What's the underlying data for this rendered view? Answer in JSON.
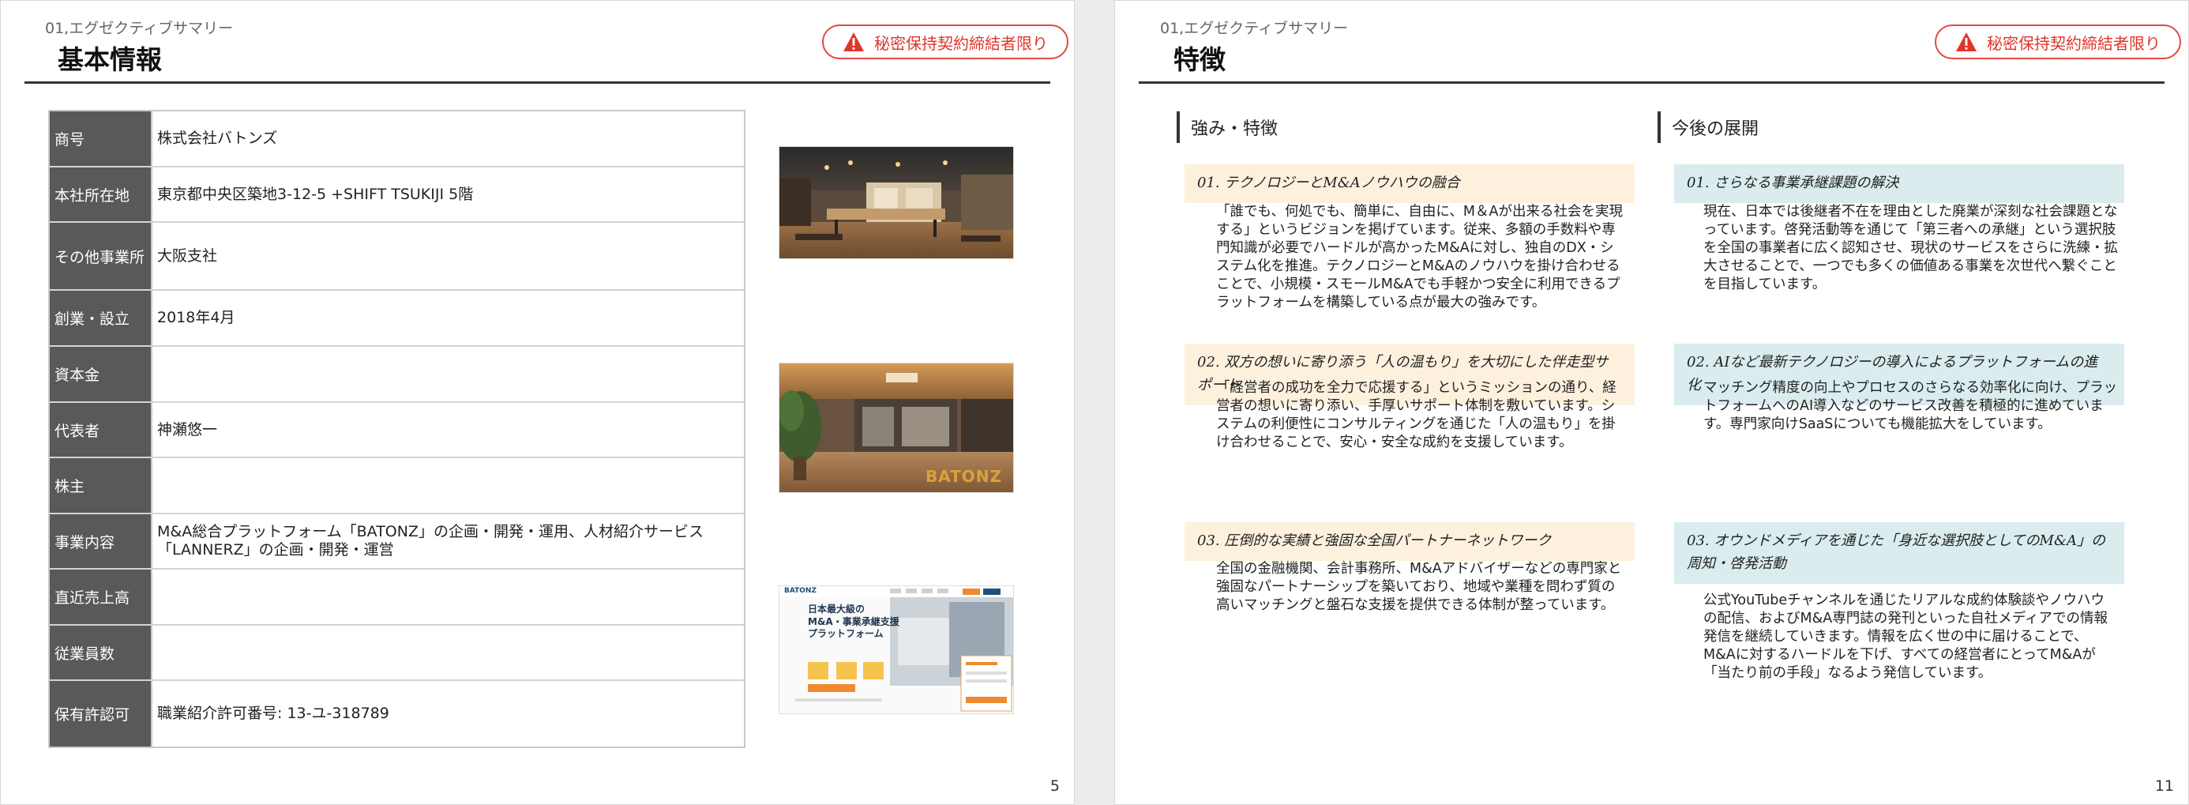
{
  "slide1": {
    "section_label": "01,エグゼクティブサマリー",
    "title": "基本情報",
    "confidential_badge": "秘密保持契約締結者限り",
    "page_number": "5",
    "rows": [
      {
        "label": "商号",
        "value": "株式会社バトンズ"
      },
      {
        "label": "本社所在地",
        "value": "東京都中央区築地3-12-5 +SHIFT TSUKIJI 5階"
      },
      {
        "label": "その他事業所",
        "value": "大阪支社"
      },
      {
        "label": "創業・設立",
        "value": "2018年4月"
      },
      {
        "label": "資本金",
        "value": ""
      },
      {
        "label": "代表者",
        "value": "神瀬悠一"
      },
      {
        "label": "株主",
        "value": ""
      },
      {
        "label": "事業内容",
        "value": "M&A総合プラットフォーム「BATONZ」の企画・開発・運用、人材紹介サービス\n「LANNERZ」の企画・開発・運営"
      },
      {
        "label": "直近売上高",
        "value": ""
      },
      {
        "label": "従業員数",
        "value": ""
      },
      {
        "label": "保有許認可",
        "value": "職業紹介許可番号: 13-ユ-318789"
      }
    ],
    "photos": [
      {
        "icon": "office-lounge-photo"
      },
      {
        "icon": "office-entrance-photo",
        "overlay_text": "BATONZ"
      },
      {
        "icon": "website-screenshot",
        "site_logo": "BATONZ",
        "headline_lines": [
          "日本最大級の",
          "M&A・事業承継支援",
          "プラットフォーム"
        ]
      }
    ]
  },
  "slide2": {
    "section_label": "01,エグゼクティブサマリー",
    "title": "特徴",
    "confidential_badge": "秘密保持契約締結者限り",
    "page_number": "11",
    "left_heading": "強み・特徴",
    "right_heading": "今後の展開",
    "left_items": [
      {
        "title": "01. テクノロジーとM&Aノウハウの融合",
        "body": "「誰でも、何処でも、簡単に、自由に、M＆Aが出来る社会を実現する」というビジョンを掲げています。従来、多額の手数料や専門知識が必要でハードルが高かったM&Aに対し、独自のDX・システム化を推進。テクノロジーとM&Aのノウハウを掛け合わせることで、小規模・スモールM&Aでも手軽かつ安全に利用できるプラットフォームを構築している点が最大の強みです。"
      },
      {
        "title": "02. 双方の想いに寄り添う「人の温もり」を大切にした伴走型サポート",
        "body": "「経営者の成功を全力で応援する」というミッションの通り、経営者の想いに寄り添い、手厚いサポート体制を敷いています。システムの利便性にコンサルティングを通じた「人の温もり」を掛け合わせることで、安心・安全な成約を支援しています。"
      },
      {
        "title": "03. 圧倒的な実績と強固な全国パートナーネットワーク",
        "body": "全国の金融機関、会計事務所、M&Aアドバイザーなどの専門家と強固なパートナーシップを築いており、地域や業種を問わず質の高いマッチングと盤石な支援を提供できる体制が整っています。"
      }
    ],
    "right_items": [
      {
        "title": "01. さらなる事業承継課題の解決",
        "body": "現在、日本では後継者不在を理由とした廃業が深刻な社会課題となっています。啓発活動等を通じて「第三者への承継」という選択肢を全国の事業者に広く認知させ、現状のサービスをさらに洗練・拡大させることで、一つでも多くの価値ある事業を次世代へ繋ぐことを目指しています。"
      },
      {
        "title": "02. AIなど最新テクノロジーの導入によるプラットフォームの進化",
        "body": "マッチング精度の向上やプロセスのさらなる効率化に向け、プラットフォームへのAI導入などのサービス改善を積極的に進めています。専門家向けSaaSについても機能拡大をしています。"
      },
      {
        "title": "03. オウンドメディアを通じた「身近な選択肢としてのM&A」の周知・啓発活動",
        "body": "公式YouTubeチャンネルを通じたリアルな成約体験談やノウハウの配信、およびM&A専門誌の発刊といった自社メディアでの情報発信を継続していきます。情報を広く世の中に届けることで、M&Aに対するハードルを下げ、すべての経営者にとってM&Aが「当たり前の手段」なるよう発信しています。"
      }
    ]
  },
  "colors": {
    "badge_red": "#e0352c",
    "header_gray": "#595959",
    "left_title_bg": "#fdf1de",
    "right_title_bg": "#daecee"
  }
}
